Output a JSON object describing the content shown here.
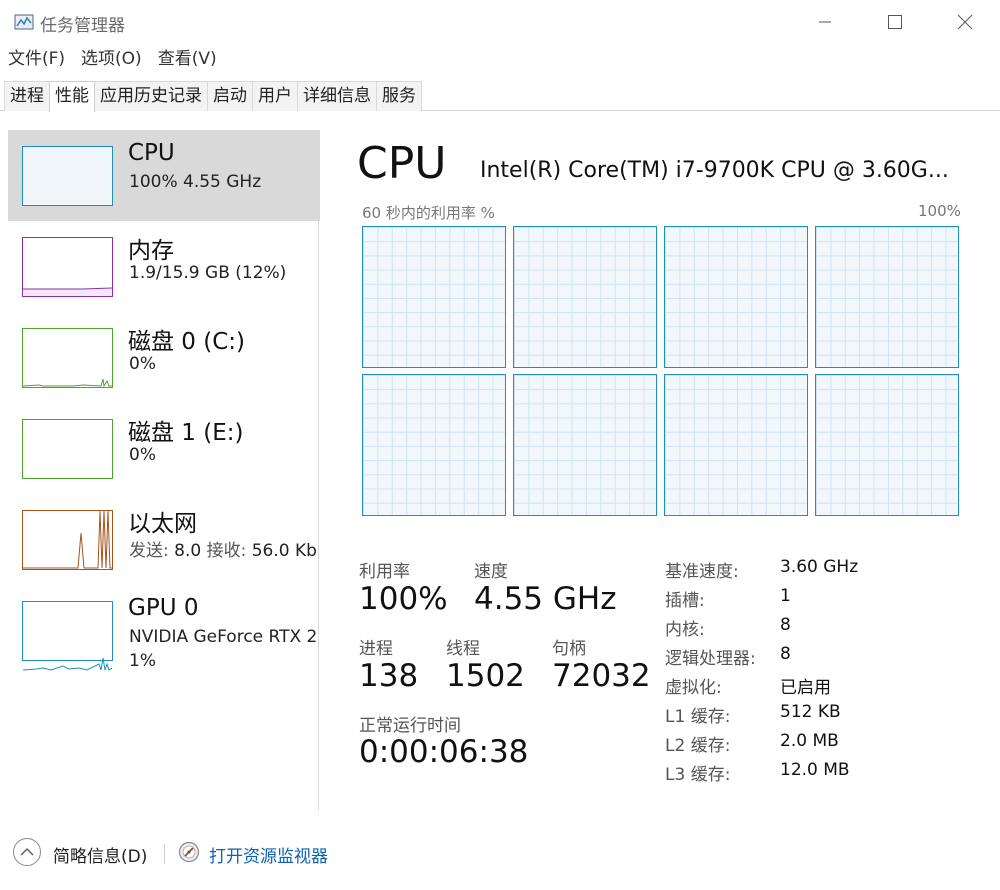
{
  "window": {
    "title": "任务管理器"
  },
  "menu": [
    "文件(F)",
    "选项(O)",
    "查看(V)"
  ],
  "tabs": [
    {
      "label": "进程",
      "active": false
    },
    {
      "label": "性能",
      "active": true
    },
    {
      "label": "应用历史记录",
      "active": false
    },
    {
      "label": "启动",
      "active": false
    },
    {
      "label": "用户",
      "active": false
    },
    {
      "label": "详细信息",
      "active": false
    },
    {
      "label": "服务",
      "active": false
    }
  ],
  "sidebar": {
    "items": [
      {
        "title": "CPU",
        "sub": "100%  4.55 GHz",
        "color": "#1e8fbf"
      },
      {
        "title": "内存",
        "sub": "1.9/15.9 GB (12%)",
        "color": "#8b2fa8"
      },
      {
        "title": "磁盘 0 (C:)",
        "sub": "0%",
        "color": "#4fa52e"
      },
      {
        "title": "磁盘 1 (E:)",
        "sub": "0%",
        "color": "#4fa52e"
      },
      {
        "title": "以太网",
        "sub_label1": "发送:",
        "sub_value1": "8.0",
        "sub_label2": "接收:",
        "sub_value2": "56.0 Kb",
        "color": "#a7541f"
      },
      {
        "title": "GPU 0",
        "sub": "NVIDIA GeForce RTX 2",
        "sub2": "1%",
        "color": "#1e8fbf"
      }
    ]
  },
  "main": {
    "title": "CPU",
    "subtitle": "Intel(R) Core(TM) i7-9700K CPU @ 3.60G...",
    "graph_caption_left": "60 秒内的利用率 %",
    "graph_caption_right": "100%",
    "stats": {
      "utilization_label": "利用率",
      "utilization_value": "100%",
      "speed_label": "速度",
      "speed_value": "4.55 GHz",
      "processes_label": "进程",
      "processes_value": "138",
      "threads_label": "线程",
      "threads_value": "1502",
      "handles_label": "句柄",
      "handles_value": "72032",
      "uptime_label": "正常运行时间",
      "uptime_value": "0:00:06:38"
    },
    "specs": [
      {
        "key": "基准速度:",
        "value": "3.60 GHz"
      },
      {
        "key": "插槽:",
        "value": "1"
      },
      {
        "key": "内核:",
        "value": "8"
      },
      {
        "key": "逻辑处理器:",
        "value": "8"
      },
      {
        "key": "虚拟化:",
        "value": "已启用"
      },
      {
        "key": "L1 缓存:",
        "value": "512 KB"
      },
      {
        "key": "L2 缓存:",
        "value": "2.0 MB"
      },
      {
        "key": "L3 缓存:",
        "value": "12.0 MB"
      }
    ]
  },
  "footer": {
    "collapse_label": "简略信息(D)",
    "monitor_link": "打开资源监视器"
  }
}
